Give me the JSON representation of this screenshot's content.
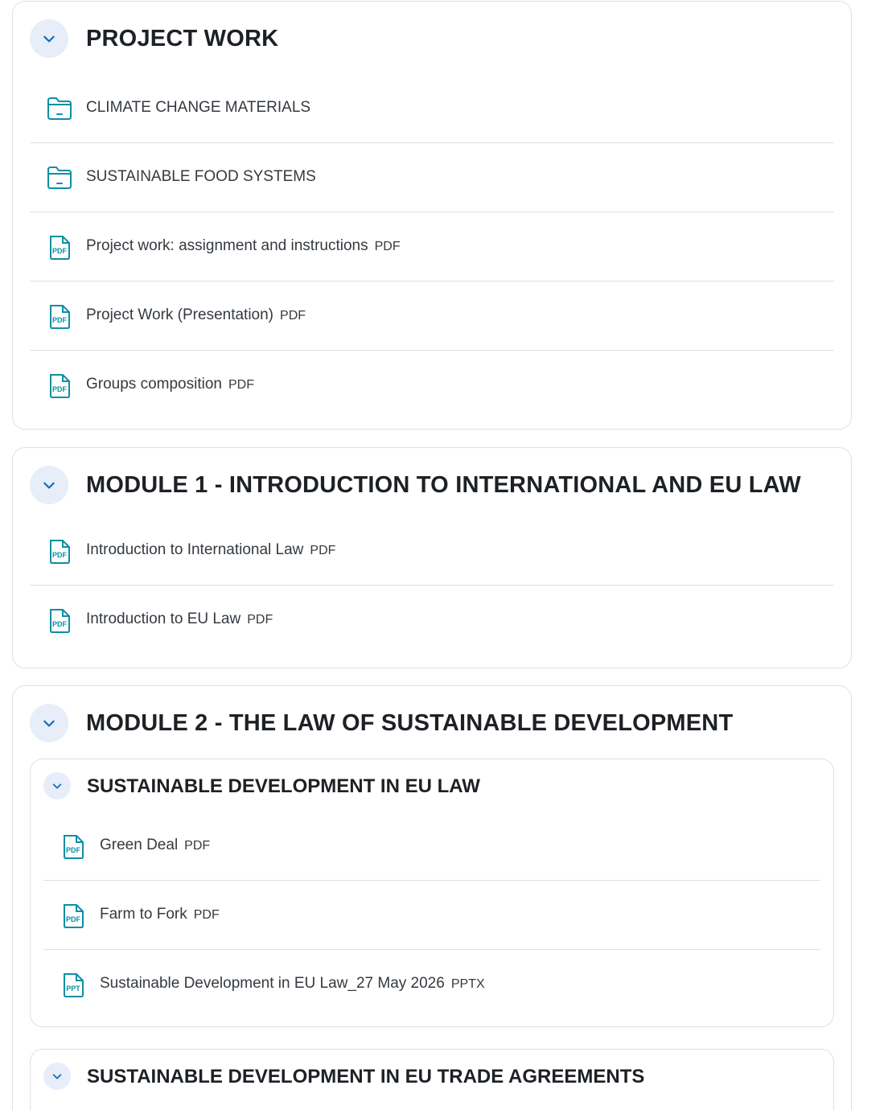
{
  "file_type_labels": {
    "pdf": "PDF",
    "pptx": "PPTX"
  },
  "sections": [
    {
      "title": "PROJECT WORK",
      "items": [
        {
          "name": "CLIMATE CHANGE MATERIALS",
          "icon": "folder-icon"
        },
        {
          "name": "SUSTAINABLE FOOD SYSTEMS",
          "icon": "folder-icon"
        },
        {
          "name": "Project work: assignment and instructions",
          "type": "PDF",
          "icon": "pdf-icon"
        },
        {
          "name": "Project Work (Presentation)",
          "type": "PDF",
          "icon": "pdf-icon"
        },
        {
          "name": "Groups composition",
          "type": "PDF",
          "icon": "pdf-icon"
        }
      ]
    },
    {
      "title": "MODULE 1 - INTRODUCTION TO INTERNATIONAL AND EU LAW",
      "items": [
        {
          "name": "Introduction to International Law",
          "type": "PDF",
          "icon": "pdf-icon"
        },
        {
          "name": "Introduction to EU Law",
          "type": "PDF",
          "icon": "pdf-icon"
        }
      ]
    },
    {
      "title": "MODULE 2 - THE LAW OF SUSTAINABLE DEVELOPMENT",
      "subsections": [
        {
          "title": "SUSTAINABLE DEVELOPMENT IN EU LAW",
          "items": [
            {
              "name": "Green Deal",
              "type": "PDF",
              "icon": "pdf-icon"
            },
            {
              "name": "Farm to Fork",
              "type": "PDF",
              "icon": "pdf-icon"
            },
            {
              "name": "Sustainable Development in EU Law_27 May 2026",
              "type": "PPTX",
              "icon": "ppt-icon"
            }
          ]
        },
        {
          "title": "SUSTAINABLE DEVELOPMENT IN EU TRADE AGREEMENTS",
          "items": []
        }
      ]
    }
  ],
  "colors": {
    "accent": "#0f6cbf",
    "icon_teal": "#0d8fa4",
    "toggle_bg": "#e7eef9",
    "border": "#dee2e6"
  }
}
